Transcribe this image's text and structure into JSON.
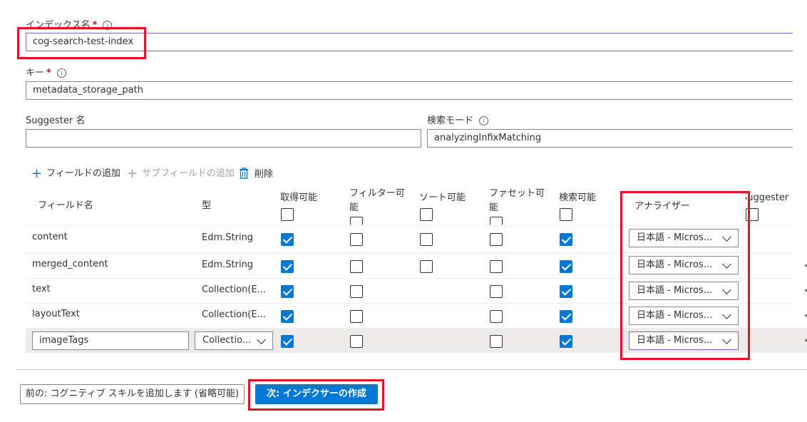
{
  "index_name": {
    "label": "インデックス名",
    "required": "*",
    "info_icon": "info-icon",
    "value": "cog-search-test-index"
  },
  "key": {
    "label": "キー",
    "required": "*",
    "info_icon": "info-icon",
    "value": "metadata_storage_path"
  },
  "suggester_name": {
    "label": "Suggester 名",
    "value": ""
  },
  "search_mode": {
    "label": "検索モード",
    "info_icon": "info-icon",
    "value": "analyzingInfixMatching"
  },
  "toolbar": {
    "add_field": "フィールドの追加",
    "add_subfield": "サブフィールドの追加",
    "delete": "削除",
    "icons": {
      "add": "plus-icon",
      "delete": "trash-icon"
    }
  },
  "table": {
    "columns": {
      "field_name": "フィールド名",
      "type": "型",
      "retrievable": "取得可能",
      "filterable_1": "フィルター可",
      "filterable_2": "能",
      "sortable": "ソート可能",
      "facetable_1": "ファセット可",
      "facetable_2": "能",
      "searchable": "検索可能",
      "analyzer": "アナライザー",
      "suggester": "Suggester"
    },
    "rows": [
      {
        "name": "content",
        "type": "Edm.String",
        "retrievable": true,
        "filterable": false,
        "sortable": false,
        "facetable": false,
        "searchable": true,
        "analyzer": "日本語 - Micros..."
      },
      {
        "name": "merged_content",
        "type": "Edm.String",
        "retrievable": true,
        "filterable": false,
        "sortable": false,
        "facetable": false,
        "searchable": true,
        "analyzer": "日本語 - Micros..."
      },
      {
        "name": "text",
        "type": "Collection(E...",
        "retrievable": true,
        "filterable": false,
        "sortable": null,
        "facetable": false,
        "searchable": true,
        "analyzer": "日本語 - Micros..."
      },
      {
        "name": "layoutText",
        "type": "Collection(E...",
        "retrievable": true,
        "filterable": false,
        "sortable": null,
        "facetable": false,
        "searchable": true,
        "analyzer": "日本語 - Micros..."
      },
      {
        "name": "imageTags",
        "type": "Collectio...",
        "retrievable": true,
        "filterable": false,
        "sortable": null,
        "facetable": false,
        "searchable": true,
        "analyzer": "日本語 - Micros..."
      }
    ]
  },
  "footer": {
    "previous_button": "前の: コグニティブ スキルを追加します (省略可能)",
    "next_button": "次: インデクサーの作成"
  },
  "colors": {
    "accent": "#0078d4",
    "highlight": "#e81123",
    "focus": "#8764b8"
  }
}
